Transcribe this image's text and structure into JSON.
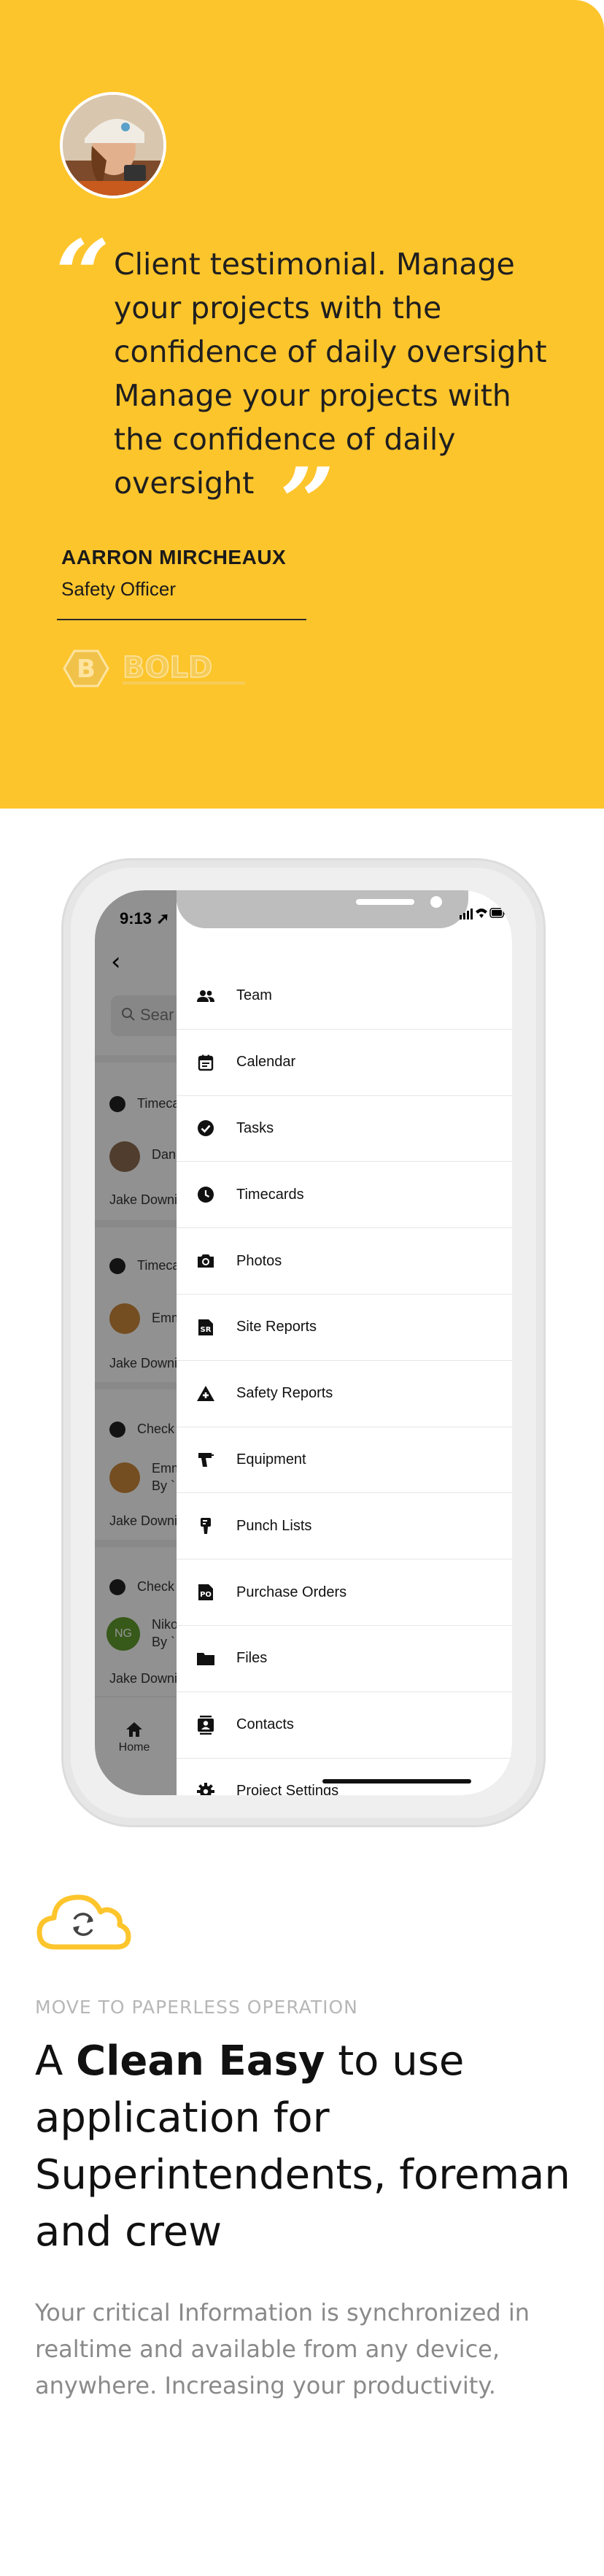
{
  "testimonial": {
    "quote": "Client testimonial. Manage your projects with the confidence of daily oversight Manage your projects with the  confidence of daily oversight",
    "author_name": "AARRON MIRCHEAUX",
    "author_role": "Safety Officer",
    "logo_word": "BOLD",
    "logo_letter": "B",
    "background_color": "#fdc52c"
  },
  "phone": {
    "status_time": "9:13",
    "background": {
      "search_label": "Sear",
      "rows": [
        {
          "label": "Timeca"
        },
        {
          "label": "Dan"
        },
        {
          "label": "Jake Downi"
        },
        {
          "label": "Timeca"
        },
        {
          "label": "Emm"
        },
        {
          "label": "Jake Downi"
        },
        {
          "label": "Check"
        },
        {
          "label": "Emm"
        },
        {
          "label": "By `"
        },
        {
          "label": "Jake Downi"
        },
        {
          "label": "Check"
        },
        {
          "label": "Niko"
        },
        {
          "label": "By `"
        },
        {
          "label": "Jake Downi"
        }
      ],
      "ng_initials": "NG",
      "tab_home": "Home"
    },
    "menu": [
      {
        "label": "Team",
        "icon": "team-icon"
      },
      {
        "label": "Calendar",
        "icon": "calendar-icon"
      },
      {
        "label": "Tasks",
        "icon": "tasks-icon"
      },
      {
        "label": "Timecards",
        "icon": "clock-icon"
      },
      {
        "label": "Photos",
        "icon": "camera-icon"
      },
      {
        "label": "Site Reports",
        "icon": "site-report-icon"
      },
      {
        "label": "Safety Reports",
        "icon": "safety-icon"
      },
      {
        "label": "Equipment",
        "icon": "drill-icon"
      },
      {
        "label": "Punch Lists",
        "icon": "punch-icon"
      },
      {
        "label": "Purchase Orders",
        "icon": "purchase-order-icon"
      },
      {
        "label": "Files",
        "icon": "folder-icon"
      },
      {
        "label": "Contacts",
        "icon": "contacts-icon"
      },
      {
        "label": "Project Settings",
        "icon": "gear-icon"
      }
    ],
    "menu_icon_text": {
      "site_reports": "SR",
      "purchase_orders": "PO"
    }
  },
  "feature": {
    "eyebrow": "MOVE TO PAPERLESS OPERATION",
    "headline_pre": "A ",
    "headline_bold": "Clean Easy",
    "headline_post": " to use application for Superintendents, foreman and crew",
    "body": "Your critical Information is synchronized in realtime and available from any device, anywhere. Increasing your productivity.",
    "accent_color": "#fdc52c"
  }
}
